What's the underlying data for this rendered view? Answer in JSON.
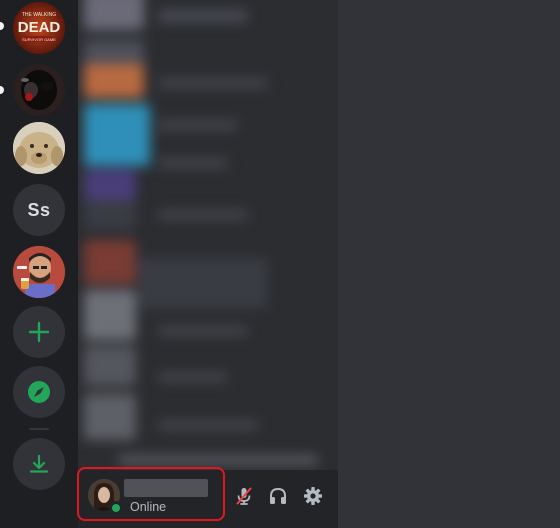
{
  "colors": {
    "rail_bg": "#1e1f22",
    "channel_bg": "#2b2d31",
    "main_bg": "#313338",
    "panel_bg": "#232428",
    "accent_green": "#23a55a",
    "highlight_red": "#e0181e",
    "mute_red": "#f23f42"
  },
  "servers": [
    {
      "name": "walking-dead-server",
      "icon": "walking-dead-logo",
      "logo_text_1": "THE WALKING",
      "logo_text_2": "DEAD",
      "logo_text_3": "SURVIVOR GAME",
      "unread": true
    },
    {
      "name": "dark-dog-server",
      "icon": "dark-animal-photo",
      "unread": true
    },
    {
      "name": "golden-dog-server",
      "icon": "golden-dog-photo",
      "unread": false
    },
    {
      "name": "ss-server",
      "label": "Ss",
      "unread": false
    },
    {
      "name": "cartoon-avatar-server",
      "icon": "cartoon-man-avatar",
      "unread": false
    }
  ],
  "actions": {
    "add_server": {
      "icon": "plus-icon"
    },
    "explore": {
      "icon": "compass-icon"
    },
    "download": {
      "icon": "download-icon"
    }
  },
  "user_panel": {
    "status": "Online",
    "controls": {
      "mute": {
        "icon": "microphone-muted-icon",
        "state": "muted"
      },
      "deafen": {
        "icon": "headphones-icon"
      },
      "settings": {
        "icon": "gear-icon"
      }
    }
  }
}
